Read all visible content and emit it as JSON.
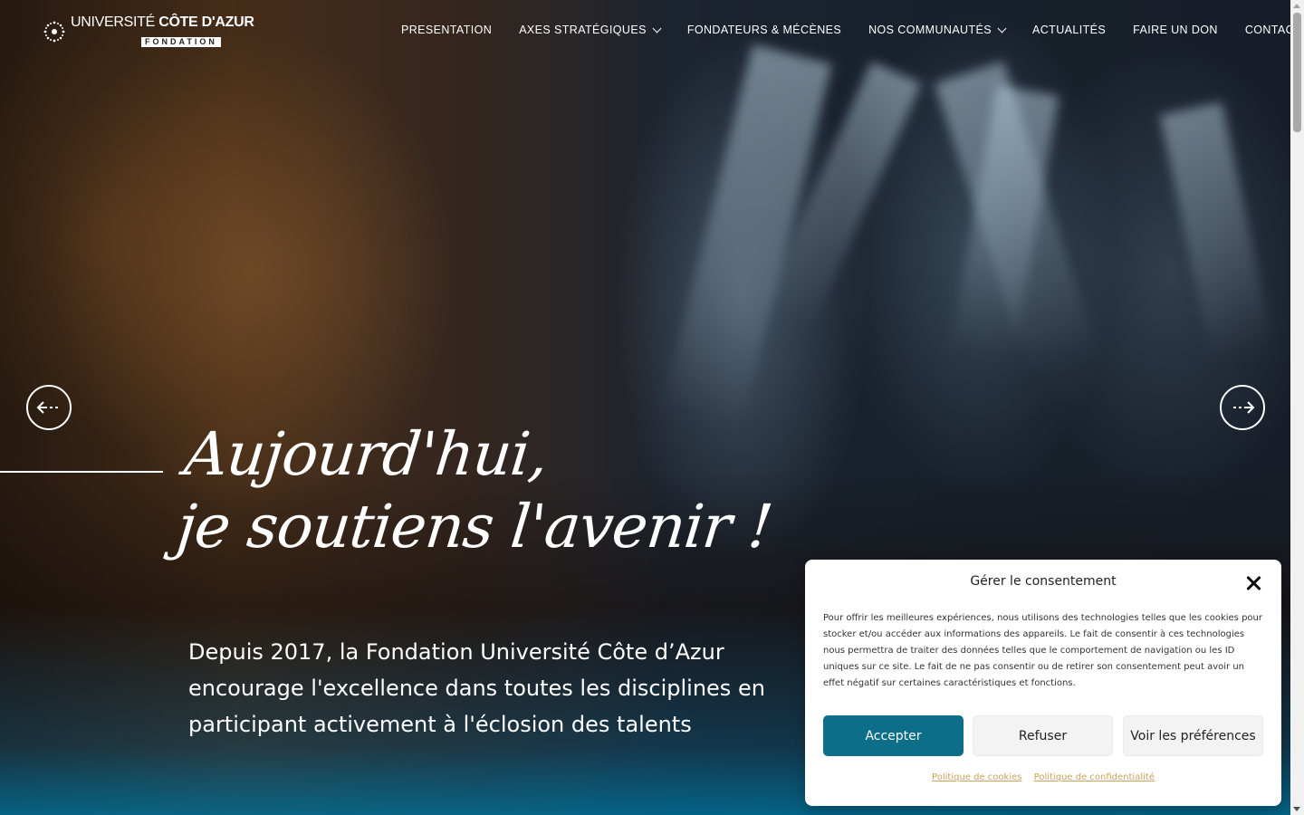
{
  "brand": {
    "line1_light": "UNIVERSITÉ",
    "line1_bold": "CÔTE D'AZUR",
    "line2": "FONDATION"
  },
  "nav": {
    "items": [
      {
        "label": "PRESENTATION",
        "has_dropdown": false
      },
      {
        "label": "AXES STRATÉGIQUES",
        "has_dropdown": true
      },
      {
        "label": "FONDATEURS & MÉCÈNES",
        "has_dropdown": false
      },
      {
        "label": "NOS COMMUNAUTÉS",
        "has_dropdown": true
      },
      {
        "label": "ACTUALITÉS",
        "has_dropdown": false
      },
      {
        "label": "FAIRE UN DON",
        "has_dropdown": false
      },
      {
        "label": "CONTACT",
        "has_dropdown": false
      }
    ]
  },
  "hero": {
    "headline_line1": "Aujourd'hui,",
    "headline_line2": "je soutiens l'avenir !",
    "subtitle": "Depuis 2017, la Fondation Université Côte d’Azur encourage l'excellence dans toutes les disciplines en participant activement à l'éclosion des talents"
  },
  "consent": {
    "title": "Gérer le consentement",
    "body": "Pour offrir les meilleures expériences, nous utilisons des technologies telles que les cookies pour stocker et/ou accéder aux informations des appareils. Le fait de consentir à ces technologies nous permettra de traiter des données telles que le comportement de navigation ou les ID uniques sur ce site. Le fait de ne pas consentir ou de retirer son consentement peut avoir un effet négatif sur certaines caractéristiques et fonctions.",
    "accept_label": "Accepter",
    "refuse_label": "Refuser",
    "prefs_label": "Voir les préférences",
    "cookie_policy_label": "Politique de cookies",
    "privacy_policy_label": "Politique de confidentialité"
  },
  "colors": {
    "accent": "#0d6e8a",
    "link": "#c9a25e"
  },
  "icons": {
    "prev": "arrow-left-circle-icon",
    "next": "arrow-right-circle-icon",
    "close": "close-icon",
    "logo": "sunburst-logo-icon"
  }
}
